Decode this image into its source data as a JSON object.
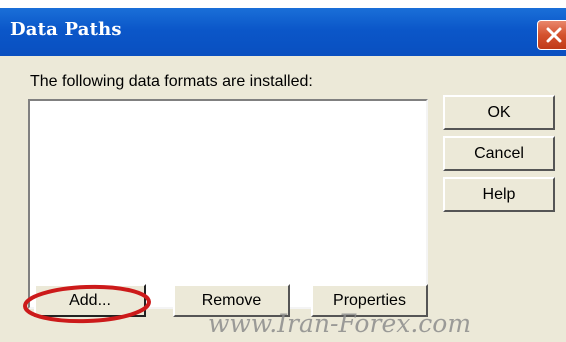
{
  "window": {
    "title": "Data Paths"
  },
  "dialog": {
    "label": "The following data formats are installed:",
    "buttons": {
      "ok": "OK",
      "cancel": "Cancel",
      "help": "Help",
      "add": "Add...",
      "remove": "Remove",
      "properties": "Properties"
    }
  },
  "watermark": "www.Iran-Forex.com",
  "colors": {
    "titlebar": "#0b57c9",
    "dialog_bg": "#ece9d8",
    "close_button": "#d4522e",
    "annotation_circle": "#cc1a1a"
  }
}
